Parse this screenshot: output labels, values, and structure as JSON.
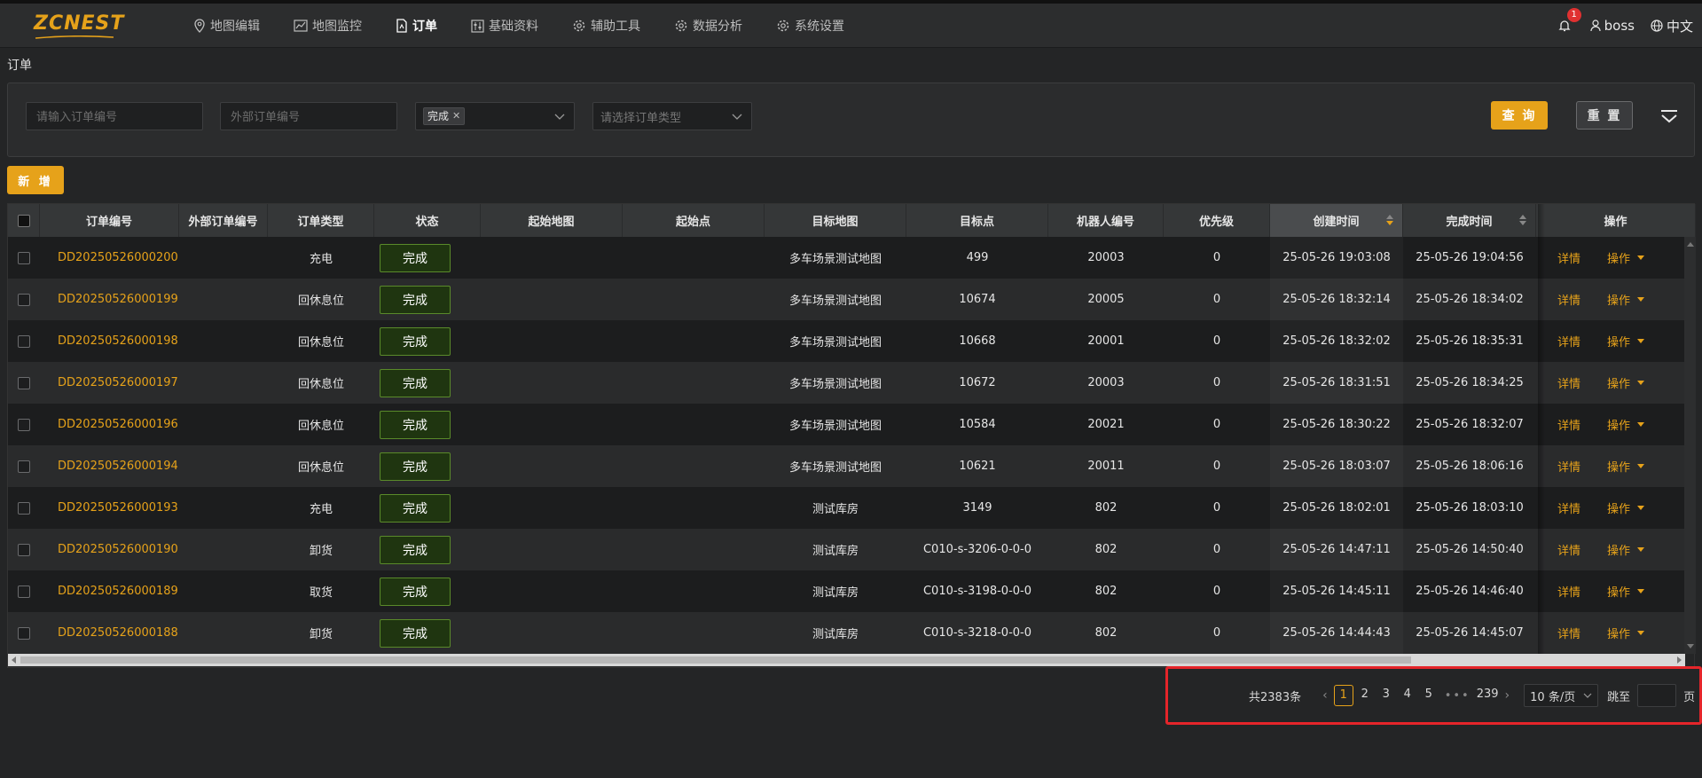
{
  "header": {
    "logo_text": "ZCNEST",
    "nav": [
      {
        "label": "地图编辑",
        "icon": "map-pin-icon",
        "active": false
      },
      {
        "label": "地图监控",
        "icon": "line-chart-icon",
        "active": false
      },
      {
        "label": "订单",
        "icon": "document-icon",
        "active": true
      },
      {
        "label": "基础资料",
        "icon": "sliders-icon",
        "active": false
      },
      {
        "label": "辅助工具",
        "icon": "gear-icon",
        "active": false
      },
      {
        "label": "数据分析",
        "icon": "gear-icon",
        "active": false
      },
      {
        "label": "系统设置",
        "icon": "gear-icon",
        "active": false
      }
    ],
    "notification_count": "1",
    "user_name": "boss",
    "language": "中文"
  },
  "breadcrumb": "订单",
  "filters": {
    "order_no_placeholder": "请输入订单编号",
    "external_no_placeholder": "外部订单编号",
    "status_tag": "完成",
    "order_type_placeholder": "请选择订单类型",
    "query_label": "查 询",
    "reset_label": "重 置"
  },
  "add_label": "新 增",
  "table": {
    "headers": [
      "订单编号",
      "外部订单编号",
      "订单类型",
      "状态",
      "起始地图",
      "起始点",
      "目标地图",
      "目标点",
      "机器人编号",
      "优先级",
      "创建时间",
      "完成时间",
      "操作"
    ],
    "detail_label": "详情",
    "action_label": "操作",
    "rows": [
      {
        "order_no": "DD20250526000200",
        "external": "",
        "type": "充电",
        "status": "完成",
        "start_map": "",
        "start_point": "",
        "target_map": "多车场景测试地图",
        "target_point": "499",
        "robot": "20003",
        "priority": "0",
        "created": "25-05-26 19:03:08",
        "finished": "25-05-26 19:04:56"
      },
      {
        "order_no": "DD20250526000199",
        "external": "",
        "type": "回休息位",
        "status": "完成",
        "start_map": "",
        "start_point": "",
        "target_map": "多车场景测试地图",
        "target_point": "10674",
        "robot": "20005",
        "priority": "0",
        "created": "25-05-26 18:32:14",
        "finished": "25-05-26 18:34:02"
      },
      {
        "order_no": "DD20250526000198",
        "external": "",
        "type": "回休息位",
        "status": "完成",
        "start_map": "",
        "start_point": "",
        "target_map": "多车场景测试地图",
        "target_point": "10668",
        "robot": "20001",
        "priority": "0",
        "created": "25-05-26 18:32:02",
        "finished": "25-05-26 18:35:31"
      },
      {
        "order_no": "DD20250526000197",
        "external": "",
        "type": "回休息位",
        "status": "完成",
        "start_map": "",
        "start_point": "",
        "target_map": "多车场景测试地图",
        "target_point": "10672",
        "robot": "20003",
        "priority": "0",
        "created": "25-05-26 18:31:51",
        "finished": "25-05-26 18:34:25"
      },
      {
        "order_no": "DD20250526000196",
        "external": "",
        "type": "回休息位",
        "status": "完成",
        "start_map": "",
        "start_point": "",
        "target_map": "多车场景测试地图",
        "target_point": "10584",
        "robot": "20021",
        "priority": "0",
        "created": "25-05-26 18:30:22",
        "finished": "25-05-26 18:32:07"
      },
      {
        "order_no": "DD20250526000194",
        "external": "",
        "type": "回休息位",
        "status": "完成",
        "start_map": "",
        "start_point": "",
        "target_map": "多车场景测试地图",
        "target_point": "10621",
        "robot": "20011",
        "priority": "0",
        "created": "25-05-26 18:03:07",
        "finished": "25-05-26 18:06:16"
      },
      {
        "order_no": "DD20250526000193",
        "external": "",
        "type": "充电",
        "status": "完成",
        "start_map": "",
        "start_point": "",
        "target_map": "测试库房",
        "target_point": "3149",
        "robot": "802",
        "priority": "0",
        "created": "25-05-26 18:02:01",
        "finished": "25-05-26 18:03:10"
      },
      {
        "order_no": "DD20250526000190",
        "external": "",
        "type": "卸货",
        "status": "完成",
        "start_map": "",
        "start_point": "",
        "target_map": "测试库房",
        "target_point": "C010-s-3206-0-0-0",
        "robot": "802",
        "priority": "0",
        "created": "25-05-26 14:47:11",
        "finished": "25-05-26 14:50:40"
      },
      {
        "order_no": "DD20250526000189",
        "external": "",
        "type": "取货",
        "status": "完成",
        "start_map": "",
        "start_point": "",
        "target_map": "测试库房",
        "target_point": "C010-s-3198-0-0-0",
        "robot": "802",
        "priority": "0",
        "created": "25-05-26 14:45:11",
        "finished": "25-05-26 14:46:40"
      },
      {
        "order_no": "DD20250526000188",
        "external": "",
        "type": "卸货",
        "status": "完成",
        "start_map": "",
        "start_point": "",
        "target_map": "测试库房",
        "target_point": "C010-s-3218-0-0-0",
        "robot": "802",
        "priority": "0",
        "created": "25-05-26 14:44:43",
        "finished": "25-05-26 14:45:07"
      }
    ]
  },
  "pagination": {
    "total": "共2383条",
    "pages": [
      "1",
      "2",
      "3",
      "4",
      "5"
    ],
    "current": "1",
    "ellipsis": "•••",
    "last": "239",
    "page_size": "10 条/页",
    "jump_label": "跳至",
    "page_unit": "页"
  },
  "colors": {
    "accent": "#e6a21a",
    "status_border": "#5a8a2a",
    "highlight": "#e5252a"
  }
}
